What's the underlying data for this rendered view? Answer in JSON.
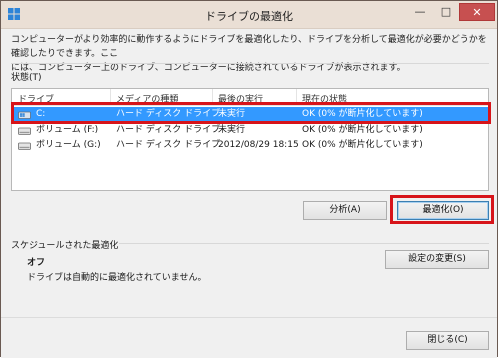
{
  "window": {
    "title": "ドライブの最適化",
    "minimize_glyph": "—",
    "maximize_glyph": "□",
    "close_glyph": "✕"
  },
  "description": {
    "line1": "コンピューターがより効率的に動作するようにドライブを最適化したり、ドライブを分析して最適化が必要かどうかを確認したりできます。ここ",
    "line2": "には、コンピューター上のドライブ、コンピューターに接続されているドライブが表示されます。"
  },
  "status": {
    "label": "状態(T)",
    "columns": [
      "ドライブ",
      "メディアの種類",
      "最後の実行",
      "現在の状態"
    ],
    "rows": [
      {
        "drive": "C:",
        "media": "ハード ディスク ドライブ",
        "last_run": "未実行",
        "state": "OK (0% が断片化しています)",
        "selected": true
      },
      {
        "drive": "ボリューム (F:)",
        "media": "ハード ディスク ドライブ",
        "last_run": "未実行",
        "state": "OK (0% が断片化しています)",
        "selected": false
      },
      {
        "drive": "ボリューム (G:)",
        "media": "ハード ディスク ドライブ",
        "last_run": "2012/08/29 18:15",
        "state": "OK (0% が断片化しています)",
        "selected": false
      }
    ]
  },
  "buttons": {
    "analyze": "分析(A)",
    "optimize": "最適化(O)",
    "change_settings": "設定の変更(S)",
    "close": "閉じる(C)"
  },
  "schedule": {
    "label": "スケジュールされた最適化",
    "state": "オフ",
    "description": "ドライブは自動的に最適化されていません。"
  },
  "colors": {
    "selection": "#3399ff",
    "annotation_highlight": "#d7141a",
    "titlebar": "#eadfd5",
    "close_button": "#c75050"
  }
}
